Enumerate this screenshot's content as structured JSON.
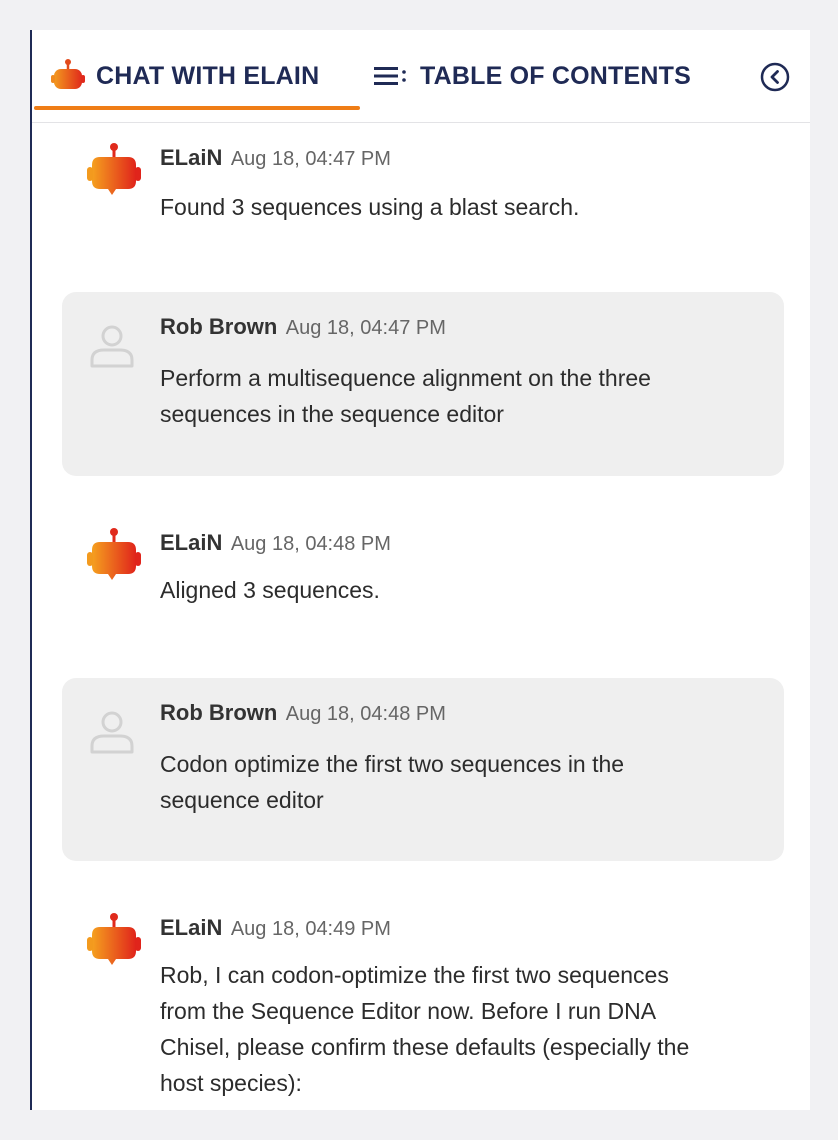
{
  "colors": {
    "accent": "#ef7d16",
    "navy": "#1f2a55",
    "bubble": "#efefef"
  },
  "tabs": {
    "chat": {
      "label": "CHAT WITH ELAIN",
      "icon": "robot-icon"
    },
    "toc": {
      "label": "TABLE OF CONTENTS",
      "icon": "list-icon"
    },
    "collapse_icon": "chevron-left-circle-icon"
  },
  "messages": [
    {
      "role": "bot",
      "author": "ELaiN",
      "time": "Aug 18, 04:47 PM",
      "text": "Found 3 sequences using a blast search."
    },
    {
      "role": "user",
      "author": "Rob Brown",
      "time": "Aug 18, 04:47 PM",
      "text": "Perform a multisequence alignment on the three\nsequences in the sequence editor"
    },
    {
      "role": "bot",
      "author": "ELaiN",
      "time": "Aug 18, 04:48 PM",
      "text": "Aligned 3 sequences."
    },
    {
      "role": "user",
      "author": "Rob Brown",
      "time": "Aug 18, 04:48 PM",
      "text": "Codon optimize the first two sequences in the\nsequence editor"
    },
    {
      "role": "bot",
      "author": "ELaiN",
      "time": "Aug 18, 04:49 PM",
      "text": "Rob, I can codon-optimize the first two sequences\nfrom the Sequence Editor now. Before I run DNA\nChisel, please confirm these defaults (especially the\nhost species):"
    }
  ]
}
